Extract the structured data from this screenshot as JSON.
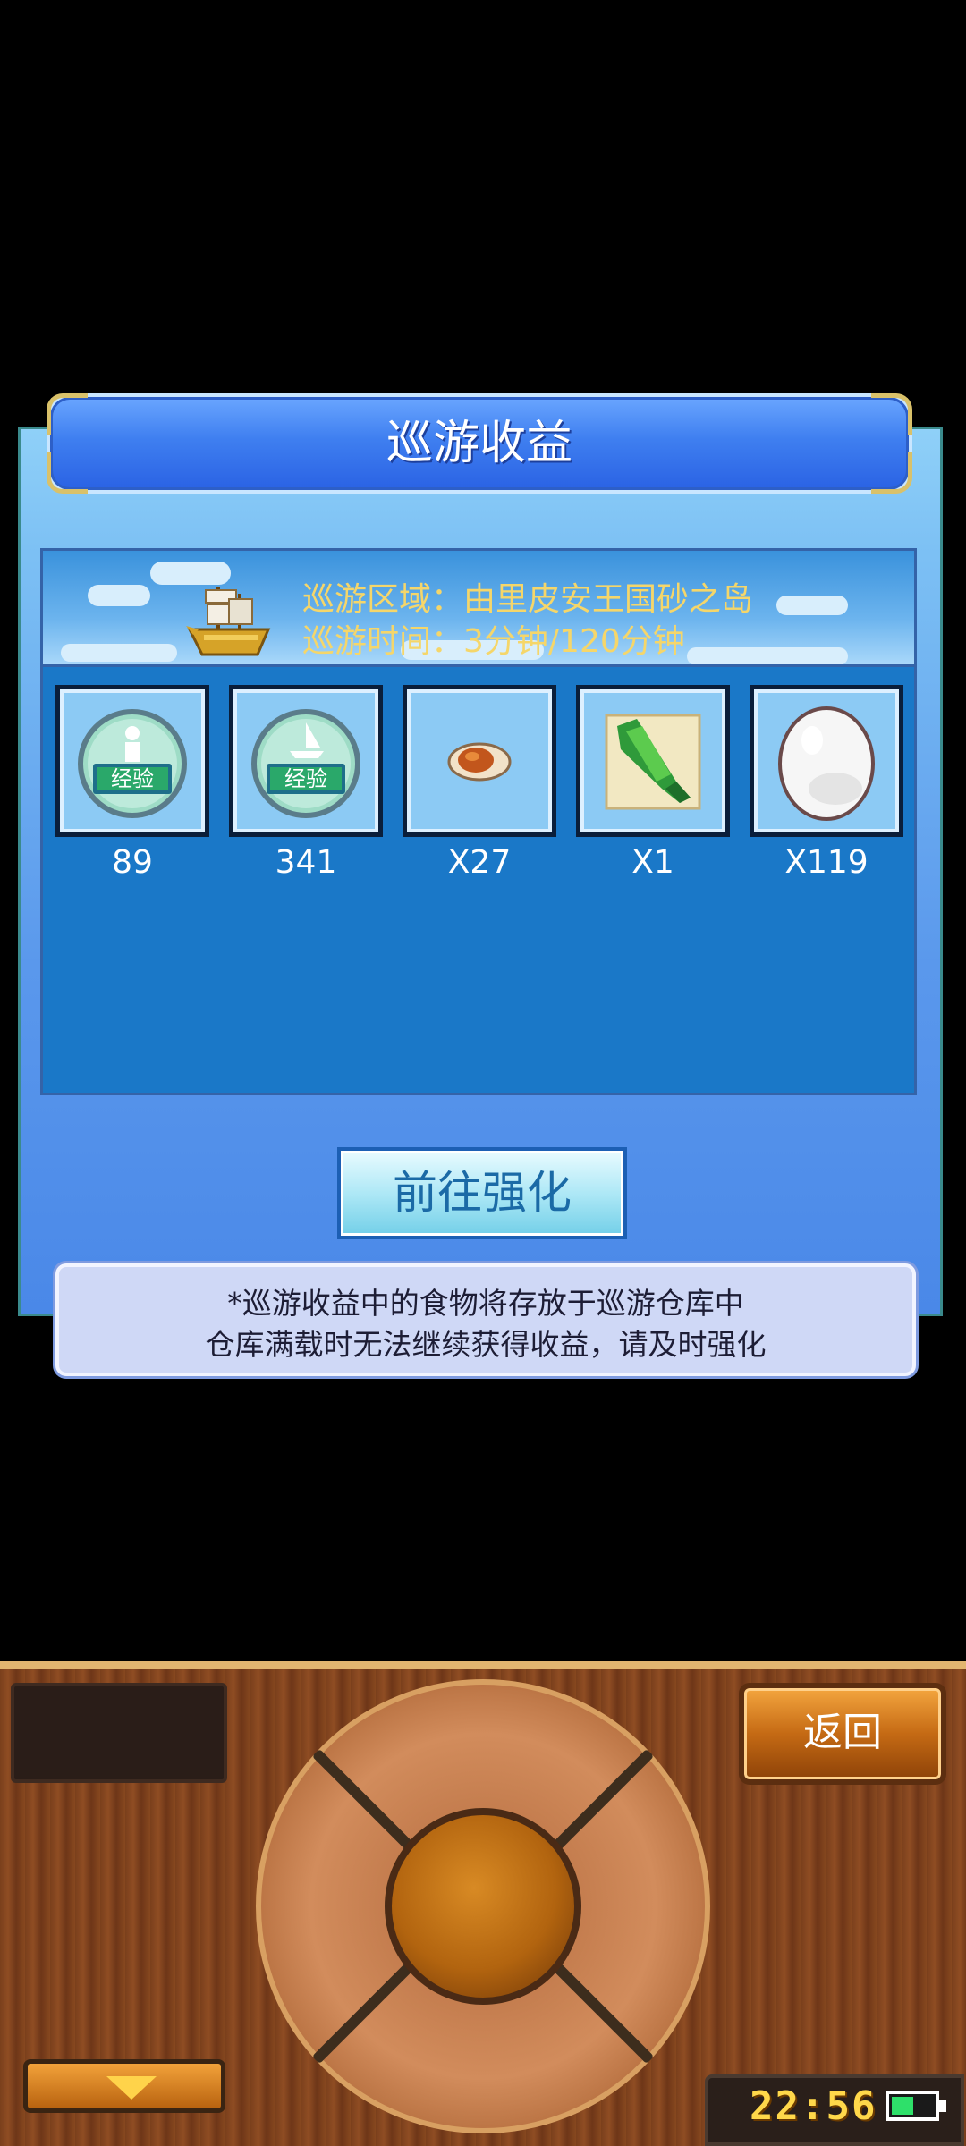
{
  "dialog": {
    "title": "巡游收益",
    "region_line": "巡游区域：由里皮安王国砂之岛",
    "time_line": "巡游时间：3分钟/120分钟"
  },
  "rewards": [
    {
      "icon": "crew-exp-icon",
      "badge": "经验",
      "count": "89"
    },
    {
      "icon": "ship-exp-icon",
      "badge": "经验",
      "count": "341"
    },
    {
      "icon": "roast-meat-icon",
      "count": "X27"
    },
    {
      "icon": "green-vegetable-icon",
      "count": "X1"
    },
    {
      "icon": "egg-icon",
      "count": "X119"
    }
  ],
  "go_button": "前往强化",
  "notice": {
    "line1": "*巡游收益中的食物将存放于巡游仓库中",
    "line2": "仓库满载时无法继续获得收益，请及时强化"
  },
  "controls": {
    "back_label": "返回",
    "clock": "22:56"
  },
  "colors": {
    "title_blue": "#3f7ff0",
    "banner_text": "#f5d66a",
    "panel_blue": "#1a78c8",
    "wood_brown": "#7a3f1c",
    "clock_yellow": "#ffd84a",
    "battery_green": "#2ee06a"
  }
}
